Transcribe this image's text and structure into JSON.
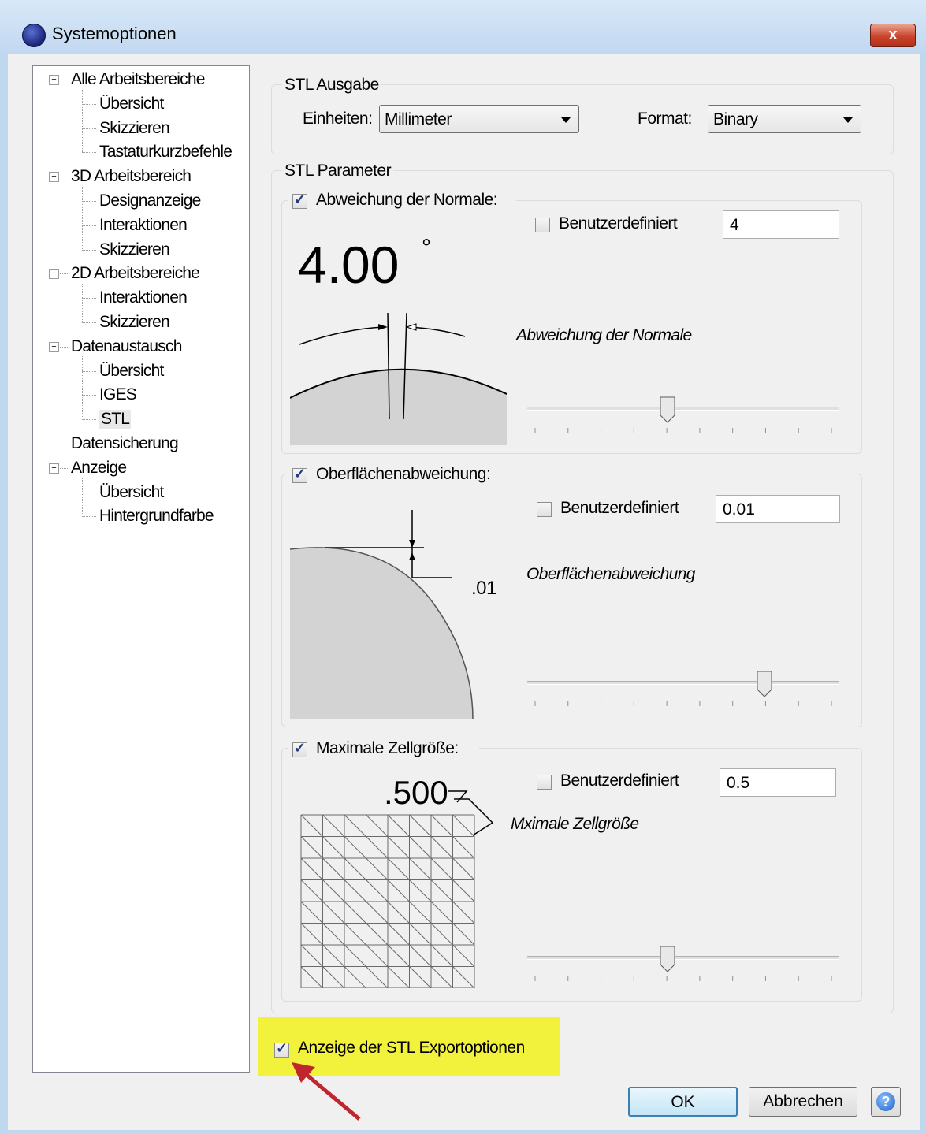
{
  "window": {
    "title": "Systemoptionen",
    "close_label": "x"
  },
  "tree": {
    "items": [
      {
        "label": "Alle Arbeitsbereiche",
        "level": 0
      },
      {
        "label": "Übersicht",
        "level": 1
      },
      {
        "label": "Skizzieren",
        "level": 1
      },
      {
        "label": "Tastaturkurzbefehle",
        "level": 1
      },
      {
        "label": "3D Arbeitsbereich",
        "level": 0
      },
      {
        "label": "Designanzeige",
        "level": 1
      },
      {
        "label": "Interaktionen",
        "level": 1
      },
      {
        "label": "Skizzieren",
        "level": 1
      },
      {
        "label": "2D Arbeitsbereiche",
        "level": 0
      },
      {
        "label": "Interaktionen",
        "level": 1
      },
      {
        "label": "Skizzieren",
        "level": 1
      },
      {
        "label": "Datenaustausch",
        "level": 0
      },
      {
        "label": "Übersicht",
        "level": 1
      },
      {
        "label": "IGES",
        "level": 1
      },
      {
        "label": "STL",
        "level": 1,
        "selected": true
      },
      {
        "label": "Datensicherung",
        "level": 0
      },
      {
        "label": "Anzeige",
        "level": 0
      },
      {
        "label": "Übersicht",
        "level": 1
      },
      {
        "label": "Hintergrundfarbe",
        "level": 1
      }
    ]
  },
  "stl_output": {
    "group_label": "STL Ausgabe",
    "units_label": "Einheiten:",
    "units_value": "Millimeter",
    "format_label": "Format:",
    "format_value": "Binary"
  },
  "stl_params": {
    "group_label": "STL Parameter",
    "normal": {
      "label": "Abweichung der Normale:",
      "checked": true,
      "custom_label": "Benutzerdefiniert",
      "custom_checked": false,
      "value": "4",
      "big_value": "4.00",
      "degree": "°",
      "caption": "Abweichung der Normale",
      "slider_fraction": 0.45
    },
    "surface": {
      "label": "Oberflächenabweichung:",
      "checked": true,
      "custom_label": "Benutzerdefiniert",
      "custom_checked": false,
      "value": "0.01",
      "diagram_value": ".01",
      "caption": "Oberflächenabweichung",
      "slider_fraction": 0.76
    },
    "cell": {
      "label": "Maximale Zellgröße:",
      "checked": true,
      "custom_label": "Benutzerdefiniert",
      "custom_checked": false,
      "value": "0.5",
      "diagram_value": ".500",
      "caption": "Mximale Zellgröße",
      "slider_fraction": 0.45
    }
  },
  "show_export_options": {
    "label": "Anzeige der STL Exportoptionen",
    "checked": true,
    "highlight_color": "#f2f23c",
    "arrow_color": "#c0262d"
  },
  "buttons": {
    "ok": "OK",
    "cancel": "Abbrechen",
    "help": "?"
  }
}
